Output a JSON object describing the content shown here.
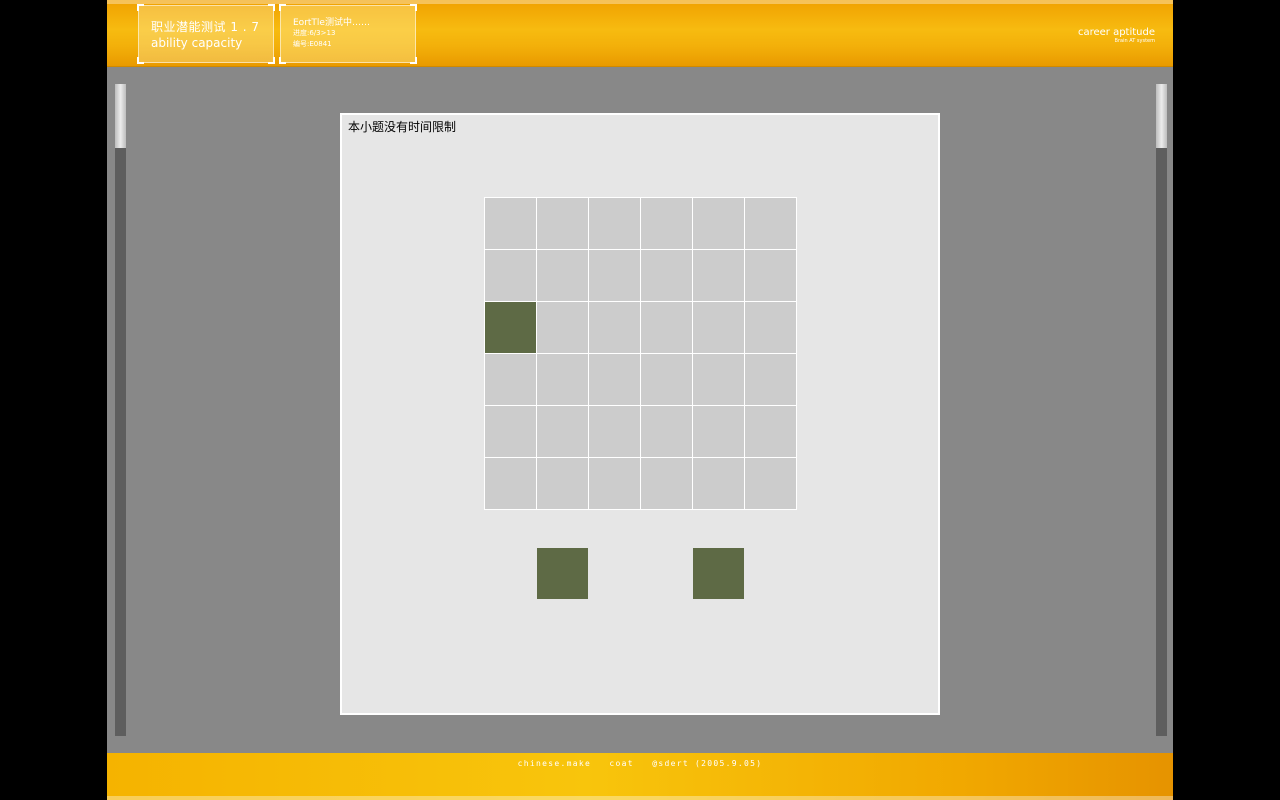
{
  "header": {
    "title_cn": "职业潜能测试 1 . 7",
    "title_en": "ability capacity",
    "status": "EortTle测试中……",
    "progress": "进度:6/3>13",
    "serial": "编号:E0841",
    "brand_title": "career aptitude",
    "brand_sub": "Brain AT system"
  },
  "question": {
    "note": "本小题没有时间限制",
    "grid_rows": 6,
    "grid_cols": 6,
    "filled_cells": [
      [
        2,
        0
      ]
    ],
    "options": [
      "option-a",
      "option-b"
    ]
  },
  "footer": {
    "credit": "chinese.make   coat   @sdert (2005.9.05)"
  },
  "colors": {
    "header_orange": "#f7bb10",
    "panel_bg": "#e6e6e6",
    "cell_empty": "#cccccc",
    "cell_filled": "#5e6a45",
    "app_bg": "#888888"
  }
}
